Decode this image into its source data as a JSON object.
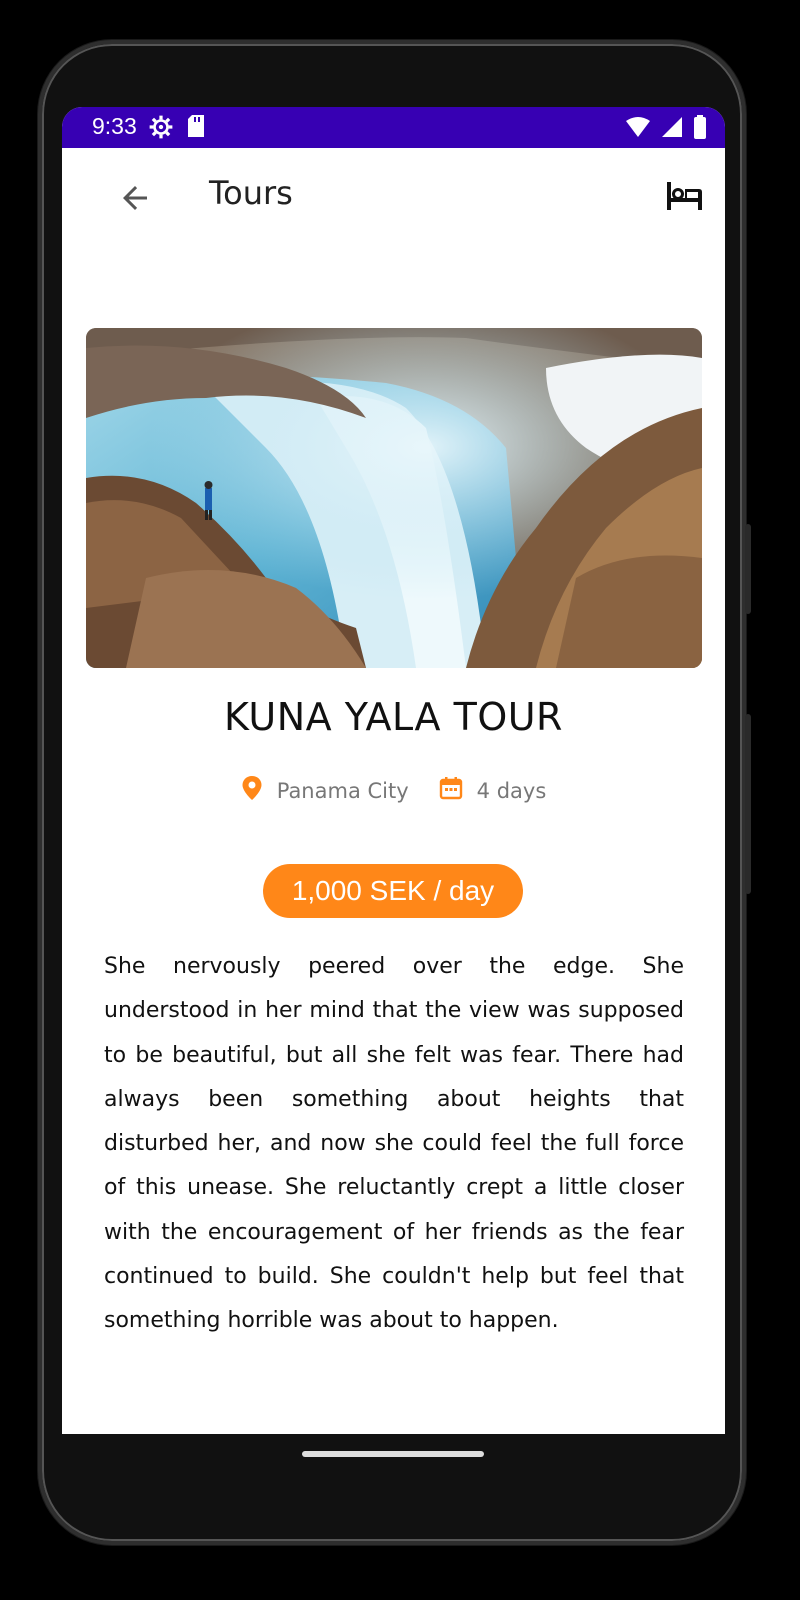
{
  "status_bar": {
    "time": "9:33",
    "icons_left": [
      "settings-icon",
      "sd-card-icon"
    ],
    "icons_right": [
      "wifi-icon",
      "signal-icon",
      "battery-icon"
    ],
    "color": "#3700b3"
  },
  "app_bar": {
    "title": "Tours",
    "back_icon": "arrow-back-icon",
    "action_icon": "hotel-icon"
  },
  "tour": {
    "image_alt": "waterfall canyon",
    "title": "KUNA YALA TOUR",
    "location": "Panama City",
    "duration": "4 days",
    "price": "1,000 SEK / day",
    "description": "She nervously peered over the edge. She understood in her mind that the view was supposed to be beautiful, but all she felt was fear. There had always been something about heights that disturbed her, and now she could feel the full force of this unease. She reluctantly crept a little closer with the encouragement of her friends as the fear continued to build. She couldn't help but feel that something horrible was about to happen."
  },
  "colors": {
    "accent": "#ff8718",
    "primary_dark": "#3700b3"
  }
}
